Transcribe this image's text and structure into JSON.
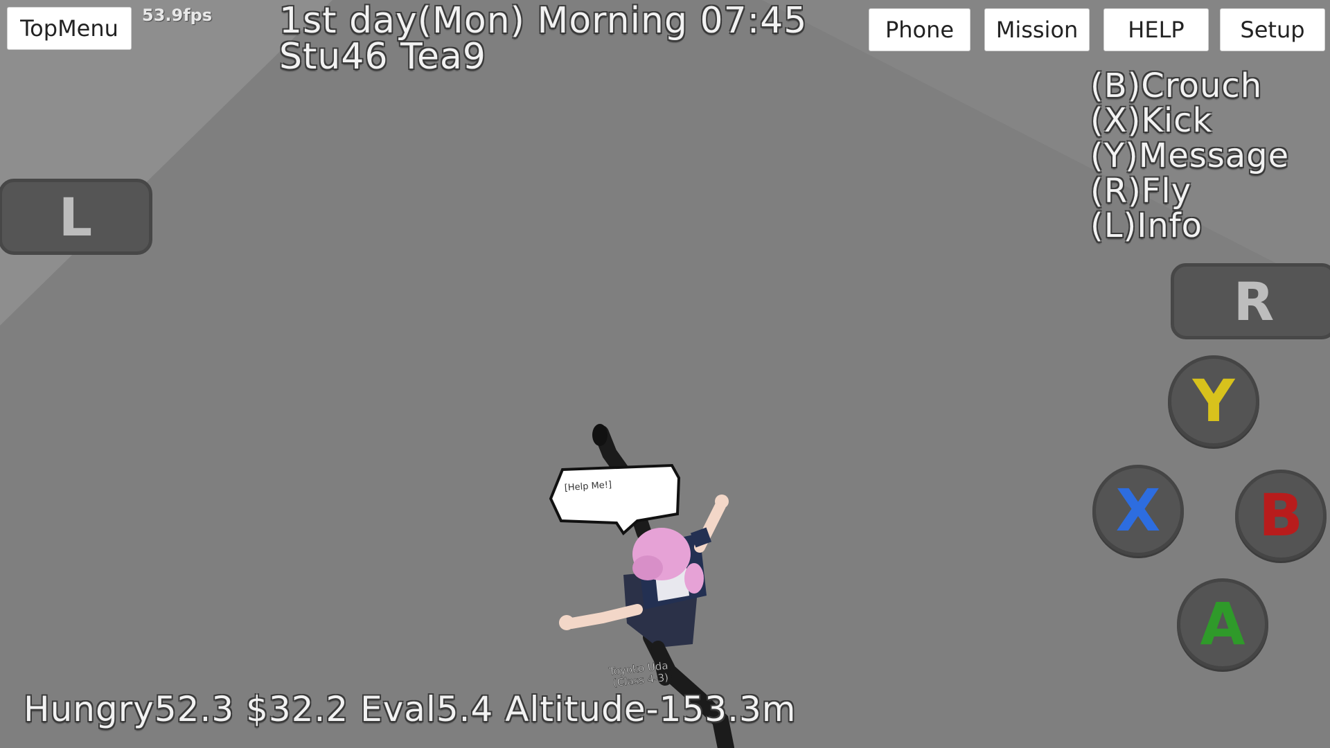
{
  "top_bar": {
    "top_menu_label": "TopMenu",
    "fps": "53.9fps",
    "datetime": "1st day(Mon)  Morning 07:45",
    "counts": "Stu46  Tea9",
    "buttons": [
      {
        "label": "Phone"
      },
      {
        "label": "Mission"
      },
      {
        "label": "HELP"
      },
      {
        "label": "Setup"
      }
    ]
  },
  "control_hints": [
    "(B)Crouch",
    "(X)Kick",
    "(Y)Message",
    "(R)Fly",
    "(L)Info"
  ],
  "status_bar": {
    "text": "Hungry52.3  $32.2  Eval5.4  Altitude-153.3m"
  },
  "gamepad": {
    "l_label": "L",
    "r_label": "R",
    "y_label": "Y",
    "x_label": "X",
    "b_label": "B",
    "a_label": "A",
    "colors": {
      "y": "#d8c21c",
      "x": "#2d6de0",
      "b": "#b81c1c",
      "a": "#2f9a2a"
    }
  },
  "character": {
    "speech_bubble": "[Help Me!]",
    "name_line1": "Toyoko Uda",
    "name_line2": "(Class 4-3)"
  }
}
